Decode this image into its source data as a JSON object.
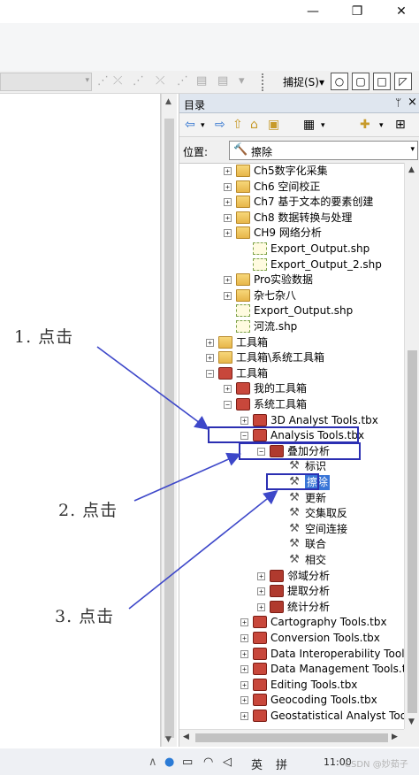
{
  "window": {
    "minimize": "—",
    "restore": "❐",
    "close": "✕"
  },
  "toolbar": {
    "snap_label": "捕捉(S)",
    "snap_dd": "▾",
    "snap_buttons": [
      "○",
      "▢",
      "□",
      "◸"
    ]
  },
  "catalog": {
    "title": "目录",
    "pin": "ᛘ",
    "close": "×",
    "location_label": "位置:",
    "location_value": "擦除"
  },
  "tree": [
    {
      "label": "Ch5数字化采集",
      "icon": "folder",
      "expander": "+"
    },
    {
      "label": "Ch6 空间校正",
      "icon": "folder",
      "expander": "+"
    },
    {
      "label": "Ch7 基于文本的要素创建",
      "icon": "folder",
      "expander": "+"
    },
    {
      "label": "Ch8 数据转换与处理",
      "icon": "folder",
      "expander": "+"
    },
    {
      "label": "CH9 网络分析",
      "icon": "folder",
      "expander": "+"
    },
    {
      "label": "Export_Output.shp",
      "icon": "shapefile",
      "expander": ""
    },
    {
      "label": "Export_Output_2.shp",
      "icon": "shapefile",
      "expander": ""
    },
    {
      "label": "Pro实验数据",
      "icon": "folder",
      "expander": "+"
    },
    {
      "label": "杂七杂八",
      "icon": "folder",
      "expander": "+"
    },
    {
      "label": "Export_Output.shp",
      "icon": "shapefile",
      "expander": ""
    },
    {
      "label": "河流.shp",
      "icon": "shapefile",
      "expander": ""
    },
    {
      "label": "工具箱",
      "icon": "folder",
      "expander": "+"
    },
    {
      "label": "工具箱\\系统工具箱",
      "icon": "folder",
      "expander": "+"
    },
    {
      "label": "工具箱",
      "icon": "toolbox",
      "expander": "−"
    },
    {
      "label": "我的工具箱",
      "icon": "toolbox",
      "expander": "+"
    },
    {
      "label": "系统工具箱",
      "icon": "toolbox",
      "expander": "−"
    },
    {
      "label": "3D Analyst Tools.tbx",
      "icon": "toolbox",
      "expander": "+"
    },
    {
      "label": "Analysis Tools.tbx",
      "icon": "toolbox",
      "expander": "−"
    },
    {
      "label": "叠加分析",
      "icon": "toolset",
      "expander": "−"
    },
    {
      "label": "标识",
      "icon": "tool",
      "expander": ""
    },
    {
      "label": "擦除",
      "icon": "tool",
      "expander": "",
      "selected": true
    },
    {
      "label": "更新",
      "icon": "tool",
      "expander": ""
    },
    {
      "label": "交集取反",
      "icon": "tool",
      "expander": ""
    },
    {
      "label": "空间连接",
      "icon": "tool",
      "expander": ""
    },
    {
      "label": "联合",
      "icon": "tool",
      "expander": ""
    },
    {
      "label": "相交",
      "icon": "tool",
      "expander": ""
    },
    {
      "label": "邻域分析",
      "icon": "toolset",
      "expander": "+"
    },
    {
      "label": "提取分析",
      "icon": "toolset",
      "expander": "+"
    },
    {
      "label": "统计分析",
      "icon": "toolset",
      "expander": "+"
    },
    {
      "label": "Cartography Tools.tbx",
      "icon": "toolbox",
      "expander": "+"
    },
    {
      "label": "Conversion Tools.tbx",
      "icon": "toolbox",
      "expander": "+"
    },
    {
      "label": "Data Interoperability Tools.t",
      "icon": "toolbox",
      "expander": "+"
    },
    {
      "label": "Data Management Tools.tbx",
      "icon": "toolbox",
      "expander": "+"
    },
    {
      "label": "Editing Tools.tbx",
      "icon": "toolbox",
      "expander": "+"
    },
    {
      "label": "Geocoding Tools.tbx",
      "icon": "toolbox",
      "expander": "+"
    },
    {
      "label": "Geostatistical Analyst Tools.",
      "icon": "toolbox",
      "expander": "+"
    }
  ],
  "annotations": [
    "1. 点击",
    "2. 点击",
    "3. 点击"
  ],
  "taskbar": {
    "ime": "英",
    "grid": "拼",
    "time": "11:00"
  },
  "watermark": "CSDN @妙茹子"
}
